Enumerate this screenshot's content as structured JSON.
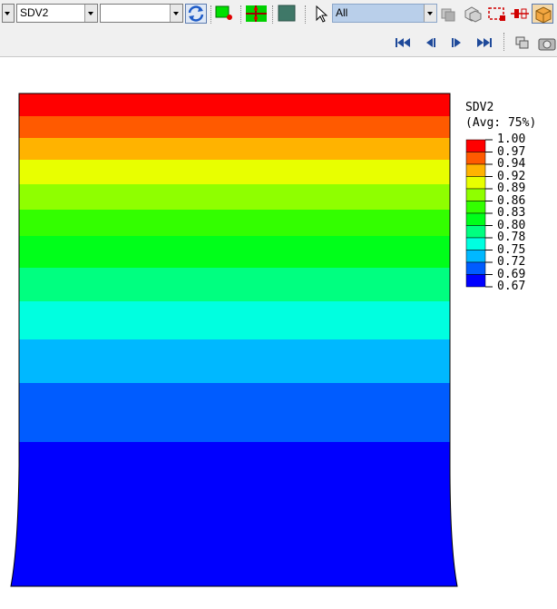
{
  "toolbar": {
    "field_combo": {
      "value": "SDV2"
    },
    "second_combo": {
      "value": ""
    },
    "selection_combo": {
      "value": "All"
    }
  },
  "legend": {
    "title": "SDV2",
    "subtitle": "(Avg: 75%)",
    "values": [
      "1.00",
      "0.97",
      "0.94",
      "0.92",
      "0.89",
      "0.86",
      "0.83",
      "0.80",
      "0.78",
      "0.75",
      "0.72",
      "0.69",
      "0.67"
    ],
    "colors": [
      "#ff0000",
      "#ff5a00",
      "#ffb300",
      "#e8ff00",
      "#8fff00",
      "#33ff00",
      "#00ff1a",
      "#00ff80",
      "#00ffe0",
      "#00b8ff",
      "#005cff",
      "#0000ff"
    ]
  },
  "contour": {
    "bands_top_to_bottom": [
      "#ff0000",
      "#ff5a00",
      "#ffb300",
      "#e8ff00",
      "#8fff00",
      "#33ff00",
      "#00ff1a",
      "#00ff80",
      "#00ffe0",
      "#00b8ff",
      "#005cff",
      "#0000ff"
    ]
  }
}
